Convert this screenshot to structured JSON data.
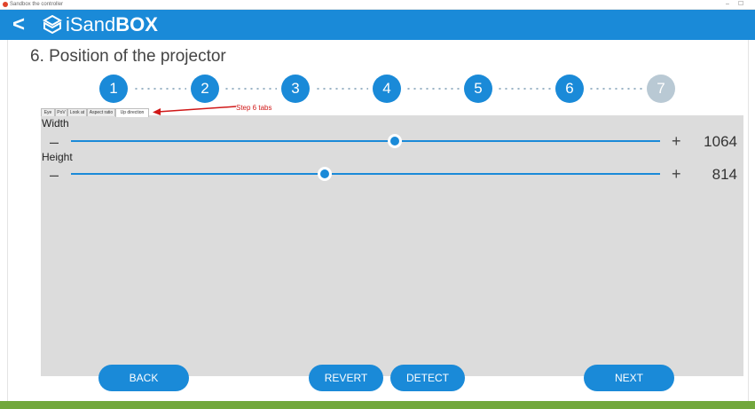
{
  "window": {
    "title": "Sandbox the controller",
    "minimize": "–",
    "maximize": "☐"
  },
  "header": {
    "back_symbol": "<",
    "logo_light": "iSand",
    "logo_bold": "BOX"
  },
  "page": {
    "title": "6. Position of the projector"
  },
  "stepper": {
    "steps": [
      "1",
      "2",
      "3",
      "4",
      "5",
      "6",
      "7"
    ],
    "current": 6
  },
  "tabs": [
    "Eye",
    "PoV",
    "Look at",
    "Aspect ratio",
    "Up direction"
  ],
  "annotation": {
    "text": "Step 6 tabs"
  },
  "sliders": {
    "width": {
      "label": "Width",
      "value": "1064",
      "minus": "–",
      "plus": "+",
      "fraction": 0.55
    },
    "height": {
      "label": "Height",
      "value": "814",
      "minus": "–",
      "plus": "+",
      "fraction": 0.43
    }
  },
  "buttons": {
    "back": "BACK",
    "revert": "REVERT",
    "detect": "DETECT",
    "next": "NEXT"
  },
  "colors": {
    "accent": "#1a8ad8",
    "footer": "#72a83c",
    "panel": "#dcdcdc",
    "annotation": "#d01818"
  }
}
